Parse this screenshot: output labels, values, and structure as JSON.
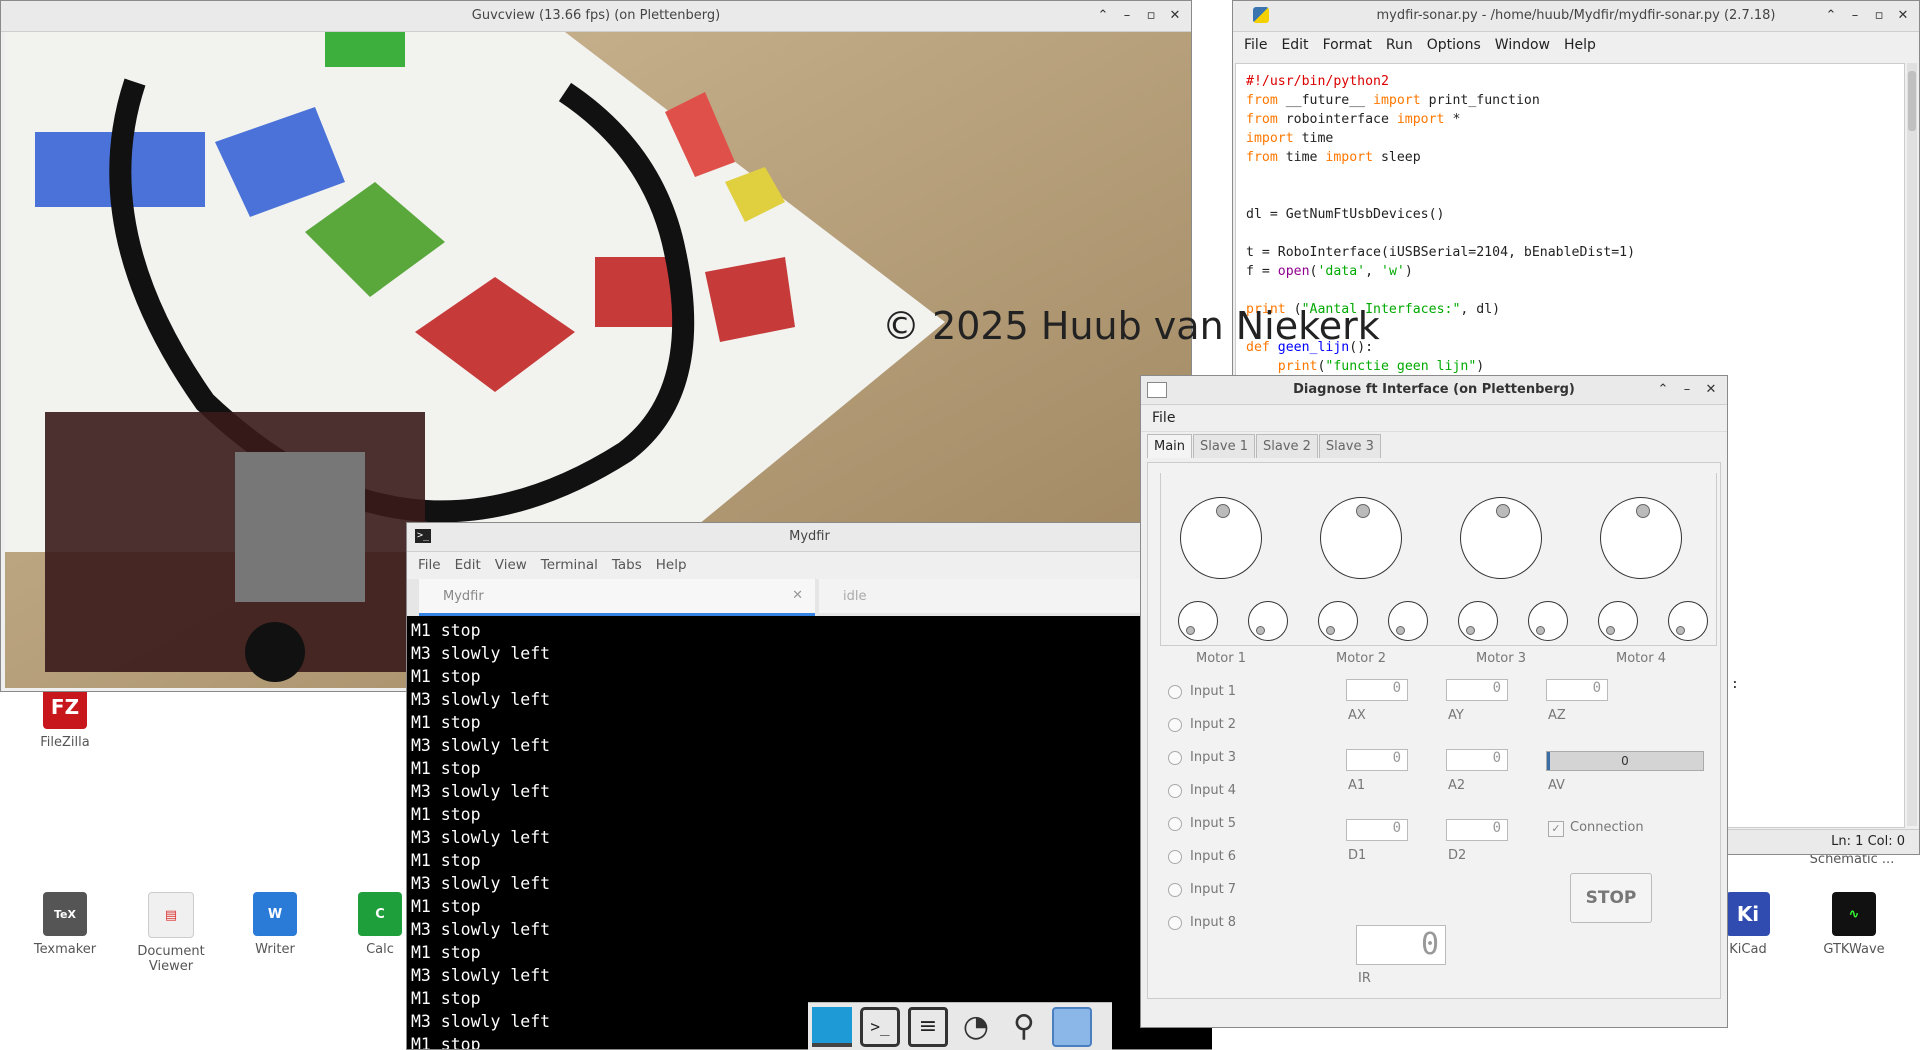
{
  "watermark": "© 2025 Huub van Niekerk",
  "desktop_icons": {
    "filezilla": "FileZilla",
    "texmaker": "Texmaker",
    "document_viewer": "Document Viewer",
    "writer": "Writer",
    "calc": "Calc",
    "schematic": "Schematic ...",
    "kicad": "KiCad",
    "gtkwave": "GTKWave"
  },
  "guvcview": {
    "title": "Guvcview  (13.66 fps) (on Plettenberg)"
  },
  "editor": {
    "title": "mydfir-sonar.py - /home/huub/Mydfir/mydfir-sonar.py (2.7.18)",
    "menu": [
      "File",
      "Edit",
      "Format",
      "Run",
      "Options",
      "Window",
      "Help"
    ],
    "status": "Ln: 1  Col: 0",
    "code": {
      "l1": "#!/usr/bin/python2",
      "l2a": "from",
      "l2b": " __future__ ",
      "l2c": "import",
      "l2d": " print_function",
      "l3a": "from",
      "l3b": " robointerface ",
      "l3c": "import",
      "l3d": " *",
      "l4a": "import",
      "l4b": " time",
      "l5a": "from",
      "l5b": " time ",
      "l5c": "import",
      "l5d": " sleep",
      "l8": "dl = GetNumFtUsbDevices()",
      "l10": "t = RoboInterface(iUSBSerial=2104, bEnableDist=1)",
      "l11a": "f = ",
      "l11b": "open",
      "l11c": "(",
      "l11d": "'data'",
      "l11e": ", ",
      "l11f": "'w'",
      "l11g": ")",
      "l13a": "print",
      "l13b": " (",
      "l13c": "\"Aantal Interfaces:\"",
      "l13d": ", dl)",
      "l15a": "def",
      "l15b": " ",
      "l15c": "geen_lijn",
      "l15d": "():",
      "l16a": "    ",
      "l16b": "print",
      "l16c": "(",
      "l16d": "\"functie geen lijn\"",
      "l16e": ")",
      "tail": ":"
    }
  },
  "terminal": {
    "title": "Mydfir",
    "menu": [
      "File",
      "Edit",
      "View",
      "Terminal",
      "Tabs",
      "Help"
    ],
    "tabs": [
      "Mydfir",
      "idle"
    ],
    "lines": [
      "M1 stop",
      "M3 slowly left",
      "M1 stop",
      "M3 slowly left",
      "M1 stop",
      "M3 slowly left",
      "M1 stop",
      "M3 slowly left",
      "M1 stop",
      "M3 slowly left",
      "M1 stop",
      "M3 slowly left",
      "M1 stop",
      "M3 slowly left",
      "M1 stop",
      "M3 slowly left",
      "M1 stop",
      "M3 slowly left",
      "M1 stop"
    ]
  },
  "diagnose": {
    "title": "Diagnose ft Interface (on Plettenberg)",
    "menu": [
      "File"
    ],
    "tabs": [
      "Main",
      "Slave 1",
      "Slave 2",
      "Slave 3"
    ],
    "motors": [
      "Motor 1",
      "Motor 2",
      "Motor 3",
      "Motor 4"
    ],
    "inputs": [
      "Input 1",
      "Input 2",
      "Input 3",
      "Input 4",
      "Input 5",
      "Input 6",
      "Input 7",
      "Input 8"
    ],
    "analog": {
      "ax": "AX",
      "ay": "AY",
      "az": "AZ",
      "a1": "A1",
      "a2": "A2",
      "av": "AV",
      "d1": "D1",
      "d2": "D2",
      "ir": "IR"
    },
    "digit": "0",
    "av_value": "0",
    "connection_label": "Connection",
    "stop_label": "STOP"
  },
  "taskbar": [
    "app-icon",
    "terminal-icon",
    "archive-icon",
    "network-icon",
    "search-icon",
    "folder-icon"
  ]
}
